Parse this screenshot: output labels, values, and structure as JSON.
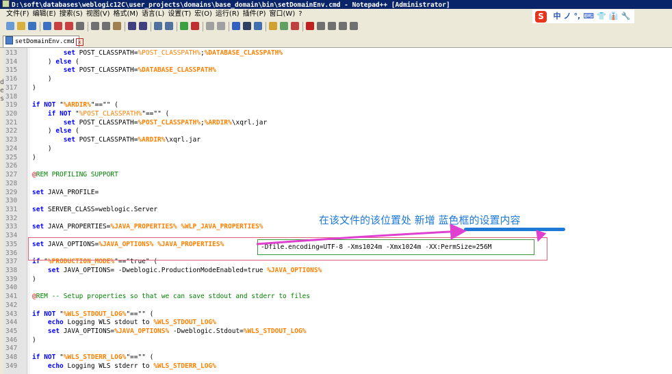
{
  "window": {
    "title": "D:\\soft\\databases\\weblogic12C\\user_projects\\domains\\base_domain\\bin\\setDomainEnv.cmd - Notepad++ [Administrator]"
  },
  "menu": [
    "文件(F)",
    "编辑(E)",
    "搜索(S)",
    "视图(V)",
    "格式(M)",
    "语言(L)",
    "设置(T)",
    "宏(O)",
    "运行(R)",
    "插件(P)",
    "窗口(W)",
    "?"
  ],
  "toolbar": {
    "buttons": [
      "new-icon",
      "open-icon",
      "save-icon",
      "save-all-icon",
      "close-icon",
      "close-all-icon",
      "print-icon",
      "cut-icon",
      "copy-icon",
      "paste-icon",
      "undo-icon",
      "redo-icon",
      "find-icon",
      "replace-icon",
      "zoom-in-icon",
      "zoom-out-icon",
      "sync-v-icon",
      "sync-h-icon",
      "word-wrap-icon",
      "all-chars-icon",
      "indent-guide-icon",
      "udl-icon",
      "doc-map-icon",
      "function-list-icon",
      "record-macro-icon",
      "stop-record-icon",
      "play-macro-icon",
      "run-macro-icon",
      "save-macro-icon"
    ]
  },
  "ime": {
    "logo": "S",
    "items": [
      "中",
      "ノ",
      "°,",
      "⌨",
      "👕",
      "👔",
      "🔧"
    ]
  },
  "tab": {
    "label": "setDomainEnv.cmd",
    "close": "x"
  },
  "left_strip": [
    "d",
    "e",
    "s"
  ],
  "editor": {
    "lines": [
      {
        "n": "313",
        "segs": [
          {
            "t": "        "
          },
          {
            "t": "set",
            "c": "kw"
          },
          {
            "t": " POST_CLASSPATH="
          },
          {
            "t": "%POST_CLASSPATH%",
            "c": "var"
          },
          {
            "t": ";"
          },
          {
            "t": "%DATABASE_CLASSPATH%",
            "c": "varb"
          }
        ]
      },
      {
        "n": "314",
        "segs": [
          {
            "t": "    ) "
          },
          {
            "t": "else",
            "c": "kw"
          },
          {
            "t": " ("
          }
        ]
      },
      {
        "n": "315",
        "segs": [
          {
            "t": "        "
          },
          {
            "t": "set",
            "c": "kw"
          },
          {
            "t": " POST_CLASSPATH="
          },
          {
            "t": "%DATABASE_CLASSPATH%",
            "c": "varb"
          }
        ]
      },
      {
        "n": "316",
        "segs": [
          {
            "t": "    )"
          }
        ]
      },
      {
        "n": "317",
        "segs": [
          {
            "t": ")"
          }
        ]
      },
      {
        "n": "318",
        "segs": []
      },
      {
        "n": "319",
        "segs": [
          {
            "t": "if",
            "c": "kw"
          },
          {
            "t": " "
          },
          {
            "t": "NOT",
            "c": "kw"
          },
          {
            "t": " \""
          },
          {
            "t": "%ARDIR%",
            "c": "varb"
          },
          {
            "t": "\"==\"\" ("
          }
        ]
      },
      {
        "n": "320",
        "segs": [
          {
            "t": "    "
          },
          {
            "t": "if",
            "c": "kw"
          },
          {
            "t": " "
          },
          {
            "t": "NOT",
            "c": "kw"
          },
          {
            "t": " \""
          },
          {
            "t": "%POST_CLASSPATH%",
            "c": "var"
          },
          {
            "t": "\"==\"\" ("
          }
        ]
      },
      {
        "n": "321",
        "segs": [
          {
            "t": "        "
          },
          {
            "t": "set",
            "c": "kw"
          },
          {
            "t": " POST_CLASSPATH="
          },
          {
            "t": "%POST_CLASSPATH%",
            "c": "varb"
          },
          {
            "t": ";"
          },
          {
            "t": "%ARDIR%",
            "c": "varb"
          },
          {
            "t": "\\xqrl.jar"
          }
        ]
      },
      {
        "n": "322",
        "segs": [
          {
            "t": "    ) "
          },
          {
            "t": "else",
            "c": "kw"
          },
          {
            "t": " ("
          }
        ]
      },
      {
        "n": "323",
        "segs": [
          {
            "t": "        "
          },
          {
            "t": "set",
            "c": "kw"
          },
          {
            "t": " POST_CLASSPATH="
          },
          {
            "t": "%ARDIR%",
            "c": "varb"
          },
          {
            "t": "\\xqrl.jar"
          }
        ]
      },
      {
        "n": "324",
        "segs": [
          {
            "t": "    )"
          }
        ]
      },
      {
        "n": "325",
        "segs": [
          {
            "t": ")"
          }
        ]
      },
      {
        "n": "326",
        "segs": []
      },
      {
        "n": "327",
        "segs": [
          {
            "t": "@",
            "c": "at"
          },
          {
            "t": "REM PROFILING SUPPORT",
            "c": "rem"
          }
        ]
      },
      {
        "n": "328",
        "segs": []
      },
      {
        "n": "329",
        "segs": [
          {
            "t": "set",
            "c": "kw"
          },
          {
            "t": " JAVA_PROFILE="
          }
        ]
      },
      {
        "n": "330",
        "segs": []
      },
      {
        "n": "331",
        "segs": [
          {
            "t": "set",
            "c": "kw"
          },
          {
            "t": " SERVER_CLASS=weblogic.Server"
          }
        ]
      },
      {
        "n": "332",
        "segs": []
      },
      {
        "n": "333",
        "segs": [
          {
            "t": "set",
            "c": "kw"
          },
          {
            "t": " JAVA_PROPERTIES="
          },
          {
            "t": "%JAVA_PROPERTIES%",
            "c": "varb"
          },
          {
            "t": " "
          },
          {
            "t": "%WLP_JAVA_PROPERTIES%",
            "c": "varb"
          }
        ]
      },
      {
        "n": "334",
        "segs": []
      },
      {
        "n": "335",
        "segs": [
          {
            "t": "set",
            "c": "kw"
          },
          {
            "t": " JAVA_OPTIONS="
          },
          {
            "t": "%JAVA_OPTIONS%",
            "c": "varb"
          },
          {
            "t": " "
          },
          {
            "t": "%JAVA_PROPERTIES%",
            "c": "varb"
          }
        ]
      },
      {
        "n": "336",
        "segs": []
      },
      {
        "n": "337",
        "segs": [
          {
            "t": "if",
            "c": "kw"
          },
          {
            "t": " \""
          },
          {
            "t": "%PRODUCTION_MODE%",
            "c": "varb"
          },
          {
            "t": "\"==\"true\" ("
          }
        ]
      },
      {
        "n": "338",
        "segs": [
          {
            "t": "    "
          },
          {
            "t": "set",
            "c": "kw"
          },
          {
            "t": " JAVA_OPTIONS= -Dweblogic.ProductionModeEnabled=true "
          },
          {
            "t": "%JAVA_OPTIONS%",
            "c": "varb"
          }
        ]
      },
      {
        "n": "339",
        "segs": [
          {
            "t": ")"
          }
        ]
      },
      {
        "n": "340",
        "segs": []
      },
      {
        "n": "341",
        "segs": [
          {
            "t": "@",
            "c": "at"
          },
          {
            "t": "REM -- Setup properties so that we can save stdout and stderr to files",
            "c": "rem"
          }
        ]
      },
      {
        "n": "342",
        "segs": []
      },
      {
        "n": "343",
        "segs": [
          {
            "t": "if",
            "c": "kw"
          },
          {
            "t": " "
          },
          {
            "t": "NOT",
            "c": "kw"
          },
          {
            "t": " \""
          },
          {
            "t": "%WLS_STDOUT_LOG%",
            "c": "varb"
          },
          {
            "t": "\"==\"\" ("
          }
        ]
      },
      {
        "n": "344",
        "segs": [
          {
            "t": "    "
          },
          {
            "t": "echo",
            "c": "kw"
          },
          {
            "t": " Logging WLS stdout to "
          },
          {
            "t": "%WLS_STDOUT_LOG%",
            "c": "varb"
          }
        ]
      },
      {
        "n": "345",
        "segs": [
          {
            "t": "    "
          },
          {
            "t": "set",
            "c": "kw"
          },
          {
            "t": " JAVA_OPTIONS="
          },
          {
            "t": "%JAVA_OPTIONS%",
            "c": "varb"
          },
          {
            "t": " -Dweblogic.Stdout="
          },
          {
            "t": "%WLS_STDOUT_LOG%",
            "c": "varb"
          }
        ]
      },
      {
        "n": "346",
        "segs": [
          {
            "t": ")"
          }
        ]
      },
      {
        "n": "347",
        "segs": []
      },
      {
        "n": "348",
        "segs": [
          {
            "t": "if",
            "c": "kw"
          },
          {
            "t": " "
          },
          {
            "t": "NOT",
            "c": "kw"
          },
          {
            "t": " \""
          },
          {
            "t": "%WLS_STDERR_LOG%",
            "c": "varb"
          },
          {
            "t": "\"==\"\" ("
          }
        ]
      },
      {
        "n": "349",
        "segs": [
          {
            "t": "    "
          },
          {
            "t": "echo",
            "c": "kw"
          },
          {
            "t": " Logging WLS stderr to "
          },
          {
            "t": "%WLS_STDERR_LOG%",
            "c": "varb"
          }
        ]
      }
    ]
  },
  "annotation": {
    "text_prefix": "在该文件的该位置处 新增 ",
    "text_highlight": "蓝色框的设置内容",
    "inserted_options": "-Dfile.encoding=UTF-8 -Xms1024m -Xmx1024m -XX:PermSize=256M",
    "accent_blue": "#1e7ad6",
    "arrow_magenta": "#e040d0",
    "box_red": "#e0607a",
    "box_green": "#3a9a3a"
  }
}
